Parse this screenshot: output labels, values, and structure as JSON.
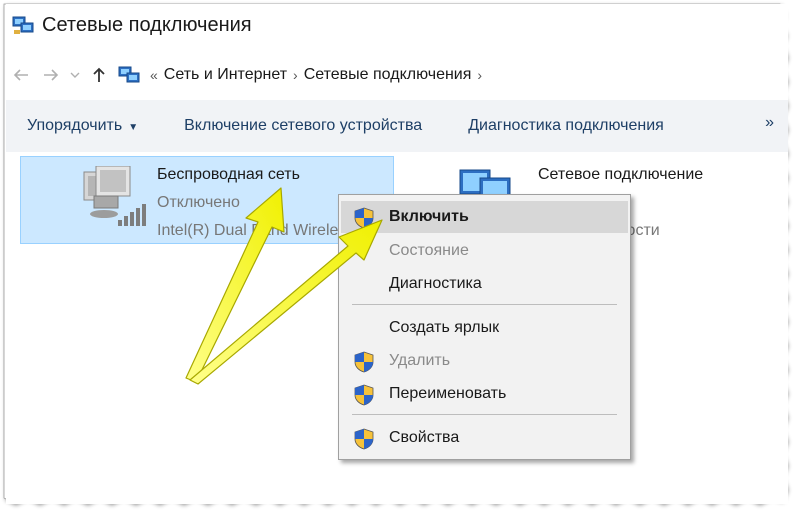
{
  "window": {
    "title": "Сетевые подключения"
  },
  "address": {
    "back_icon": "arrow-left-icon",
    "forward_icon": "arrow-right-icon",
    "recent_icon": "chevron-down-icon",
    "up_icon": "arrow-up-icon",
    "root_sep": "«",
    "crumbs": [
      "Сеть и Интернет",
      "Сетевые подключения"
    ],
    "sep": "›"
  },
  "toolbar": {
    "organize": "Упорядочить",
    "enable_device": "Включение сетевого устройства",
    "diagnose": "Диагностика подключения",
    "more": "»"
  },
  "items": [
    {
      "name": "Беспроводная сеть",
      "status": "Отключено",
      "adapter": "Intel(R) Dual Band Wireless"
    },
    {
      "name": "Сетевое подключение",
      "adapter": "охости"
    }
  ],
  "context_menu": {
    "enable": "Включить",
    "status": "Состояние",
    "diagnostics": "Диагностика",
    "create_shortcut": "Создать ярлык",
    "delete": "Удалить",
    "rename": "Переименовать",
    "properties": "Свойства"
  },
  "colors": {
    "selection": "#cce8ff",
    "selection_border": "#99d1ff",
    "toolbar_bg": "#f1f3f6",
    "toolbar_text": "#1e3f66",
    "arrow": "#f3f31a"
  }
}
